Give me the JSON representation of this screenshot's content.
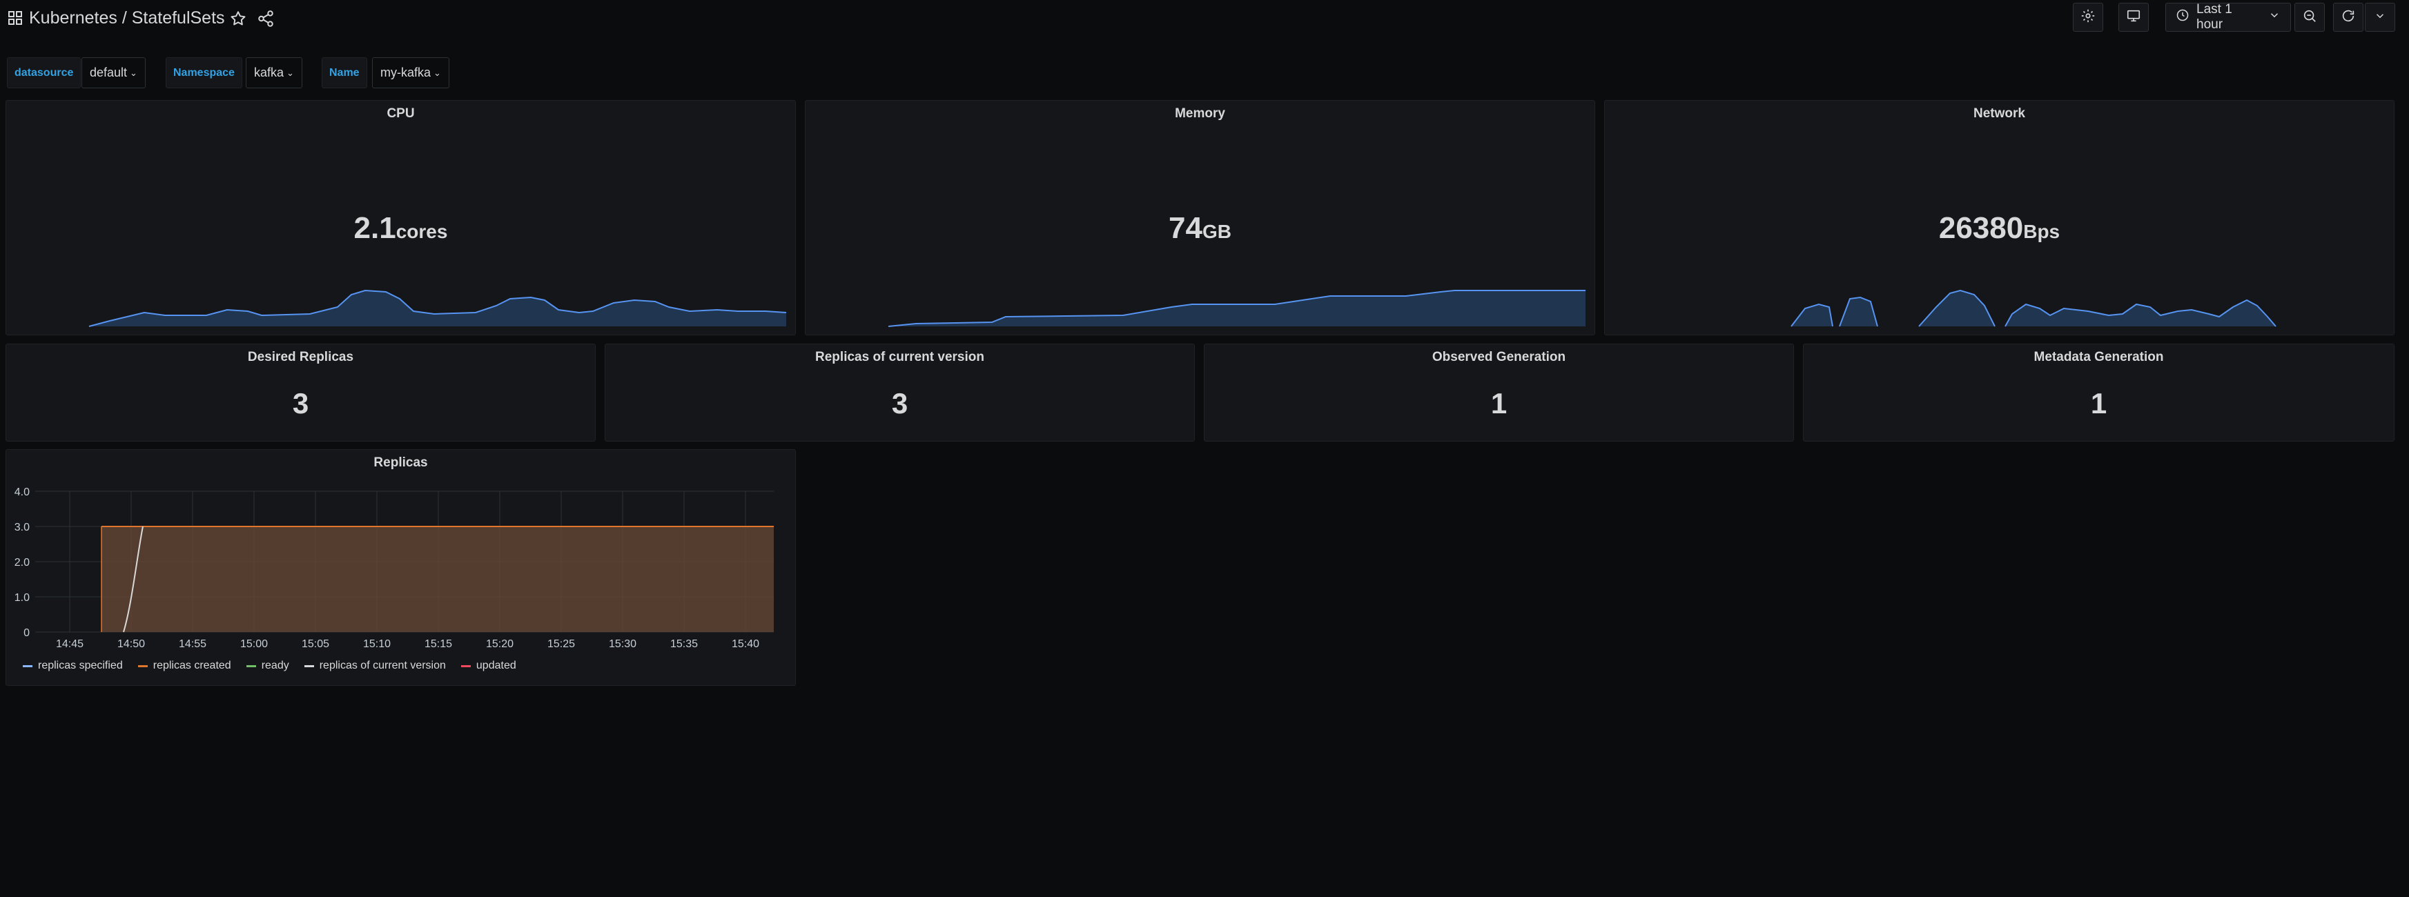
{
  "header": {
    "breadcrumb_folder": "Kubernetes",
    "breadcrumb_separator": "/",
    "dashboard_title": "StatefulSets",
    "time_range": "Last 1 hour"
  },
  "variables": [
    {
      "label": "datasource",
      "value": "default"
    },
    {
      "label": "Namespace",
      "value": "kafka"
    },
    {
      "label": "Name",
      "value": "my-kafka"
    }
  ],
  "panels": {
    "cpu": {
      "title": "CPU",
      "value": "2.1",
      "unit": "cores"
    },
    "memory": {
      "title": "Memory",
      "value": "74",
      "unit": "GB"
    },
    "network": {
      "title": "Network",
      "value": "26380",
      "unit": "Bps"
    },
    "desired": {
      "title": "Desired Replicas",
      "value": "3"
    },
    "current": {
      "title": "Replicas of current version",
      "value": "3"
    },
    "observed": {
      "title": "Observed Generation",
      "value": "1"
    },
    "metadata": {
      "title": "Metadata Generation",
      "value": "1"
    },
    "replicas": {
      "title": "Replicas"
    }
  },
  "colors": {
    "accent_blue": "#33a2e5",
    "spark_line": "#5794f2",
    "spark_fill": "#1f3550",
    "replicas_fill": "#6a4a35",
    "replicas_line": "#e0752d",
    "ready_line": "#d8d9da"
  },
  "chart_data": {
    "type": "area",
    "title": "Replicas",
    "x": [
      "14:45",
      "14:50",
      "14:55",
      "15:00",
      "15:05",
      "15:10",
      "15:15",
      "15:20",
      "15:25",
      "15:30",
      "15:35",
      "15:40"
    ],
    "y_ticks": [
      "0",
      "1.0",
      "2.0",
      "3.0",
      "4.0"
    ],
    "ylim": [
      0,
      4
    ],
    "grid": true,
    "legend_position": "bottom-left",
    "series": [
      {
        "name": "replicas specified",
        "values": [
          0,
          3,
          3,
          3,
          3,
          3,
          3,
          3,
          3,
          3,
          3,
          3
        ]
      },
      {
        "name": "replicas created",
        "values": [
          0,
          3,
          3,
          3,
          3,
          3,
          3,
          3,
          3,
          3,
          3,
          3
        ]
      },
      {
        "name": "ready",
        "values": [
          0,
          3,
          3,
          3,
          3,
          3,
          3,
          3,
          3,
          3,
          3,
          3
        ]
      },
      {
        "name": "replicas of current version",
        "values": [
          0,
          3,
          3,
          3,
          3,
          3,
          3,
          3,
          3,
          3,
          3,
          3
        ]
      },
      {
        "name": "updated",
        "values": [
          0,
          3,
          3,
          3,
          3,
          3,
          3,
          3,
          3,
          3,
          3,
          3
        ]
      }
    ],
    "legend_colors": [
      "#8ab8ff",
      "#e0752d",
      "#73bf69",
      "#d8d9da",
      "#f2495c"
    ]
  }
}
